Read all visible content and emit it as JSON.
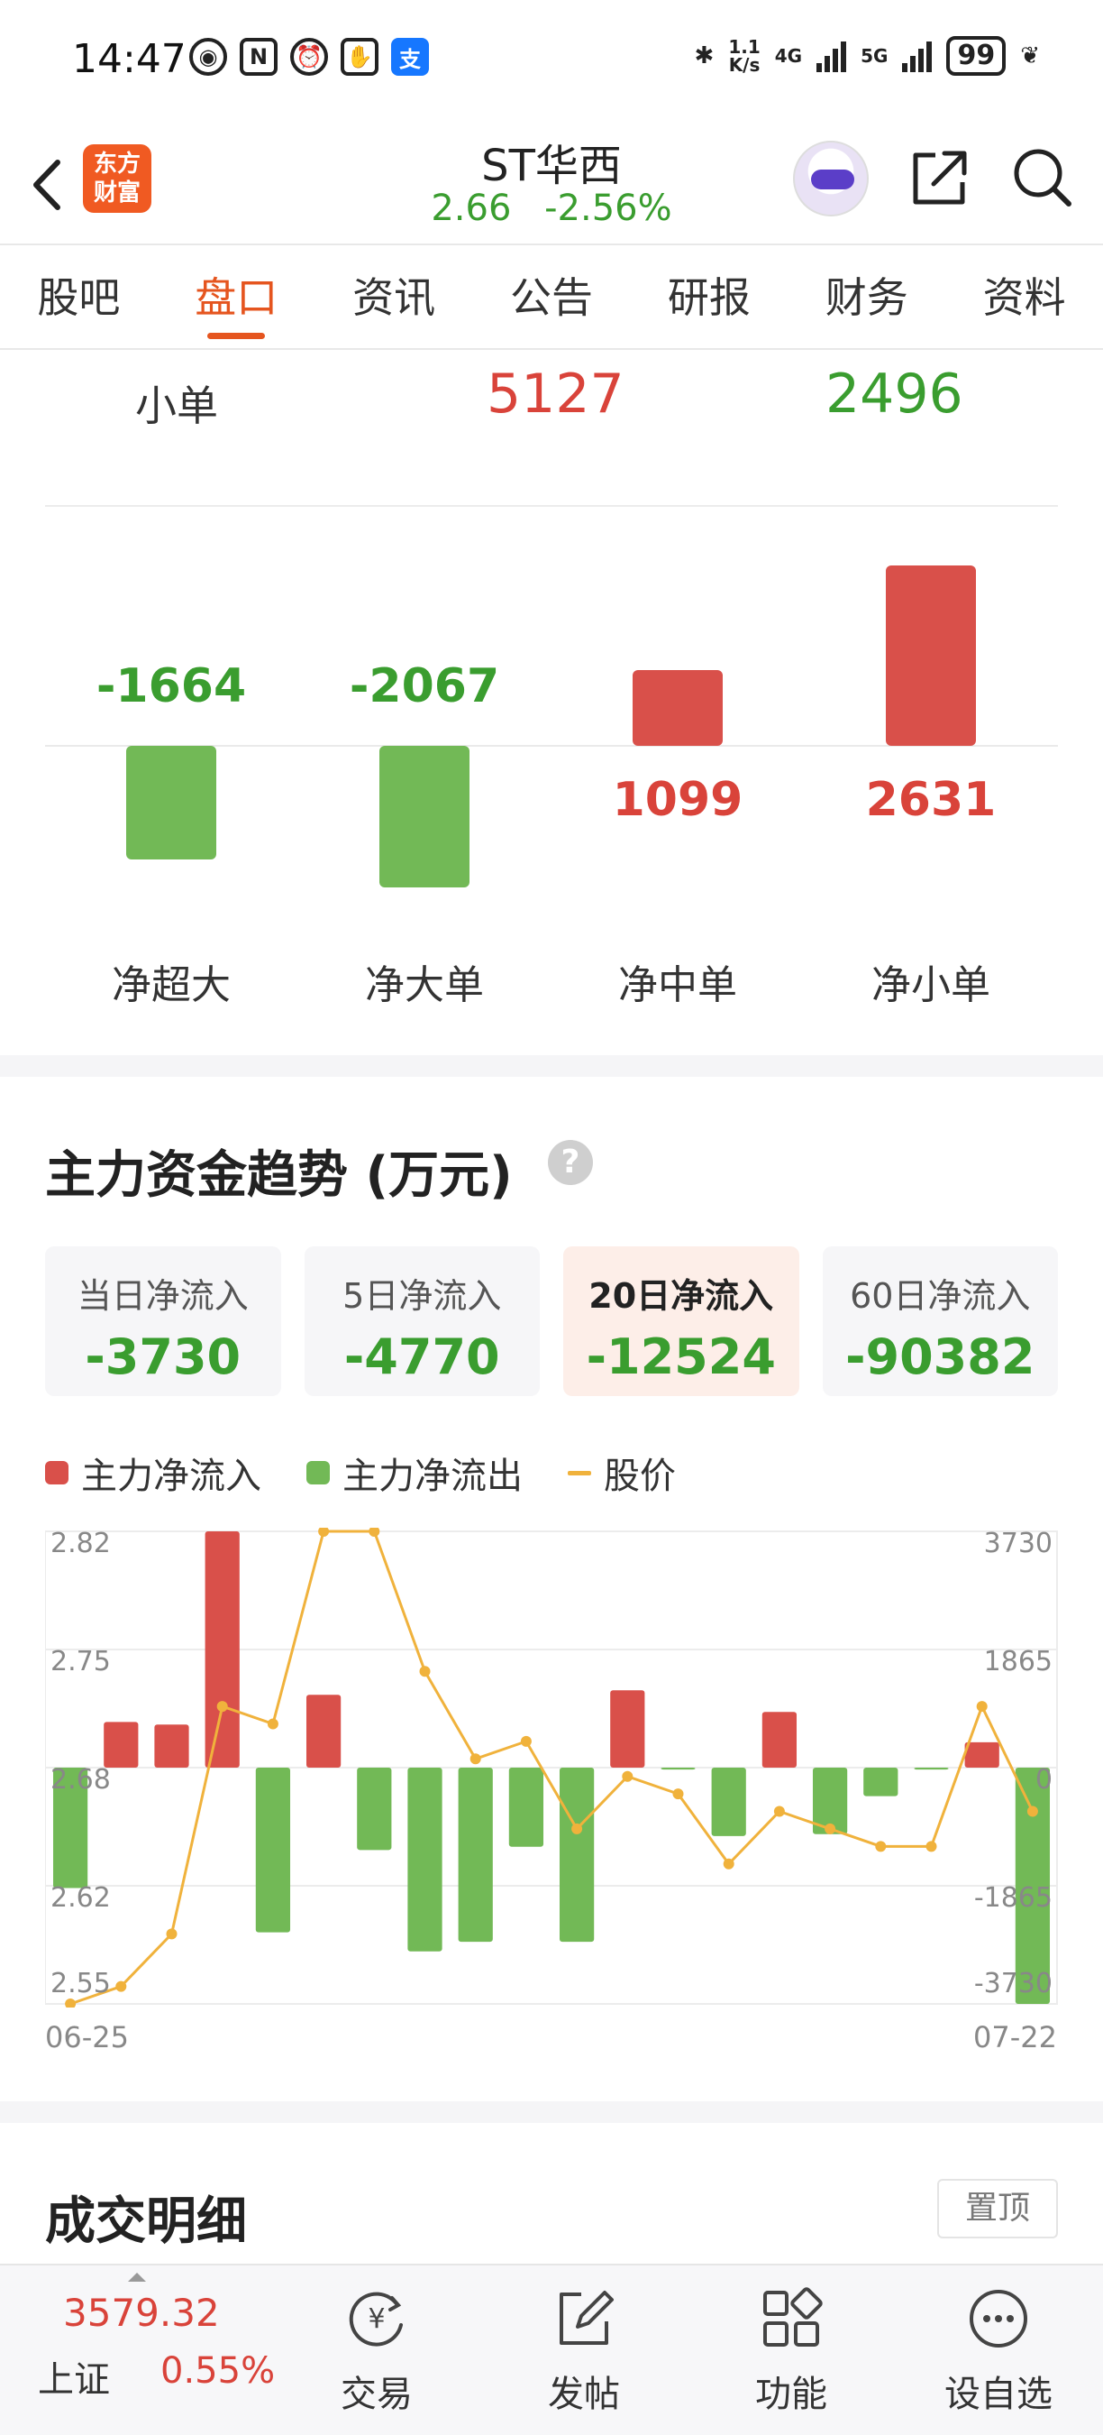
{
  "status_bar": {
    "time": "14:47",
    "net_speed_top": "1.1",
    "net_speed_bottom": "K/s",
    "net_4g": "4G",
    "net_5g": "5G",
    "battery": "99"
  },
  "header": {
    "logo_line1": "东方",
    "logo_line2": "财富",
    "stock_name": "ST华西",
    "price": "2.66",
    "change_pct": "-2.56%"
  },
  "tabs": [
    {
      "label": "股吧",
      "active": false
    },
    {
      "label": "盘口",
      "active": true
    },
    {
      "label": "资讯",
      "active": false
    },
    {
      "label": "公告",
      "active": false
    },
    {
      "label": "研报",
      "active": false
    },
    {
      "label": "财务",
      "active": false
    },
    {
      "label": "资料",
      "active": false
    }
  ],
  "small_order_row": {
    "label": "小单",
    "inflow": "5127",
    "outflow": "2496"
  },
  "net_flow": {
    "items": [
      {
        "label": "净超大",
        "value": -1664,
        "display": "-1664"
      },
      {
        "label": "净大单",
        "value": -2067,
        "display": "-2067"
      },
      {
        "label": "净中单",
        "value": 1099,
        "display": "1099"
      },
      {
        "label": "净小单",
        "value": 2631,
        "display": "2631"
      }
    ]
  },
  "trend": {
    "title": "主力资金趋势 (万元)",
    "help": "?",
    "cards": [
      {
        "label": "当日净流入",
        "value": "-3730",
        "active": false
      },
      {
        "label": "5日净流入",
        "value": "-4770",
        "active": false
      },
      {
        "label": "20日净流入",
        "value": "-12524",
        "active": true
      },
      {
        "label": "60日净流入",
        "value": "-90382",
        "active": false
      }
    ],
    "legend": {
      "inflow": "主力净流入",
      "outflow": "主力净流出",
      "price": "股价"
    }
  },
  "chart_data": {
    "type": "bar",
    "x_start_label": "06-25",
    "x_end_label": "07-22",
    "left_axis_ticks": [
      "2.82",
      "2.75",
      "2.68",
      "2.62",
      "2.55"
    ],
    "right_axis_ticks": [
      "3730",
      "1865",
      "0",
      "-1865",
      "-3730"
    ],
    "left_ylim": [
      2.55,
      2.82
    ],
    "right_ylim": [
      -3730,
      3730
    ],
    "series": [
      {
        "name": "主力净流入",
        "values": [
          -1900,
          720,
          680,
          3730,
          -2600,
          1150,
          -1300,
          -2900,
          -2750,
          -1250,
          -2750,
          1220,
          -30,
          -1080,
          880,
          -1050,
          -450,
          -30,
          400,
          -3730
        ]
      },
      {
        "name": "股价",
        "values": [
          2.55,
          2.56,
          2.59,
          2.72,
          2.71,
          2.82,
          2.82,
          2.74,
          2.69,
          2.7,
          2.65,
          2.68,
          2.67,
          2.63,
          2.66,
          2.65,
          2.64,
          2.64,
          2.72,
          2.66
        ]
      }
    ],
    "colors": {
      "inflow": "#d9504a",
      "outflow": "#72b956",
      "price": "#f0b23c"
    }
  },
  "deals": {
    "title": "成交明细",
    "pin_label": "置顶"
  },
  "bottom_bar": {
    "index_value": "3579.32",
    "index_name": "上证",
    "index_change": "0.55%",
    "nav": [
      {
        "label": "交易",
        "icon": "trade-icon"
      },
      {
        "label": "发帖",
        "icon": "post-icon"
      },
      {
        "label": "功能",
        "icon": "apps-icon"
      },
      {
        "label": "设自选",
        "icon": "more-icon"
      }
    ]
  }
}
